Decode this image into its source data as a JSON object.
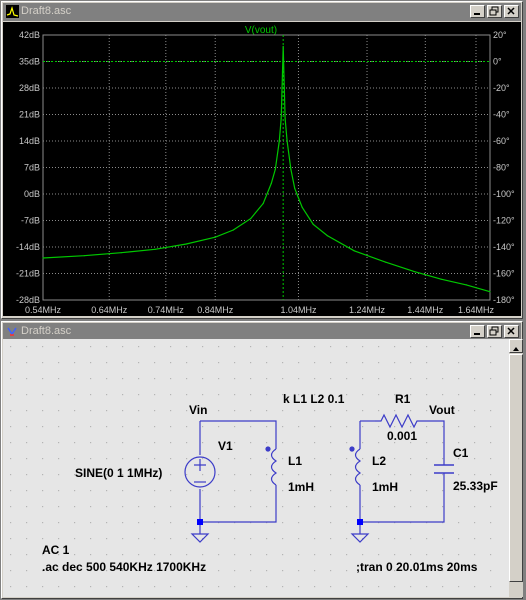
{
  "plot_window": {
    "title": "Draft8.asc",
    "trace_label": "V(vout)",
    "colors": {
      "trace": "#00c800",
      "grid": "#8c8c8c",
      "axis_text": "#c8c8c8",
      "cursor": "#00c800"
    }
  },
  "schematic_window": {
    "title": "Draft8.asc",
    "labels": {
      "vin": "Vin",
      "vout": "Vout",
      "coupling": "k L1 L2 0.1",
      "r1_name": "R1",
      "r1_value": "0.001",
      "v1_name": "V1",
      "v1_value": "SINE(0 1 1MHz)",
      "l1_name": "L1",
      "l1_value": "1mH",
      "l2_name": "L2",
      "l2_value": "1mH",
      "c1_name": "C1",
      "c1_value": "25.33pF",
      "directive_ac1": "AC 1",
      "directive_ac": ".ac dec 500 540KHz 1700KHz",
      "directive_tran": ";tran 0 20.01ms 20ms"
    },
    "colors": {
      "wire": "#0000c8",
      "component": "#0000c8",
      "text": "#000000",
      "bg": "#e6e6e6",
      "dot": "#b4b4b4",
      "node": "#0000ff"
    }
  },
  "chart_data": {
    "type": "line",
    "title": "V(vout)",
    "x_ticks": [
      "0.54MHz",
      "0.64MHz",
      "0.74MHz",
      "0.84MHz",
      "1.04MHz",
      "1.24MHz",
      "1.44MHz",
      "1.64MHz"
    ],
    "y_left_ticks": [
      "42dB",
      "35dB",
      "28dB",
      "21dB",
      "14dB",
      "7dB",
      "0dB",
      "-7dB",
      "-14dB",
      "-21dB",
      "-28dB"
    ],
    "y_right_ticks": [
      "20°",
      "0°",
      "-20°",
      "-40°",
      "-60°",
      "-80°",
      "-100°",
      "-120°",
      "-140°",
      "-160°",
      "-180°"
    ],
    "xlim_mhz": [
      0.54,
      1.7
    ],
    "ylim_db": [
      -28,
      42
    ],
    "x_scale": "log",
    "grid": true,
    "resonance_cursor_mhz": 1.0,
    "series": [
      {
        "name": "V(vout)",
        "x_mhz": [
          0.54,
          0.6,
          0.66,
          0.72,
          0.78,
          0.84,
          0.88,
          0.92,
          0.95,
          0.97,
          0.98,
          0.99,
          0.995,
          1.0,
          1.005,
          1.01,
          1.02,
          1.03,
          1.05,
          1.08,
          1.12,
          1.2,
          1.3,
          1.4,
          1.5,
          1.6,
          1.7
        ],
        "y_db": [
          -16.9,
          -16.3,
          -15.5,
          -14.6,
          -13.2,
          -11.4,
          -9.5,
          -6.5,
          -2.5,
          2.8,
          6.5,
          14,
          20,
          39,
          20,
          14,
          6.5,
          1.5,
          -3.5,
          -8,
          -11,
          -15,
          -18,
          -20.5,
          -22.5,
          -24,
          -25.8
        ]
      }
    ]
  }
}
